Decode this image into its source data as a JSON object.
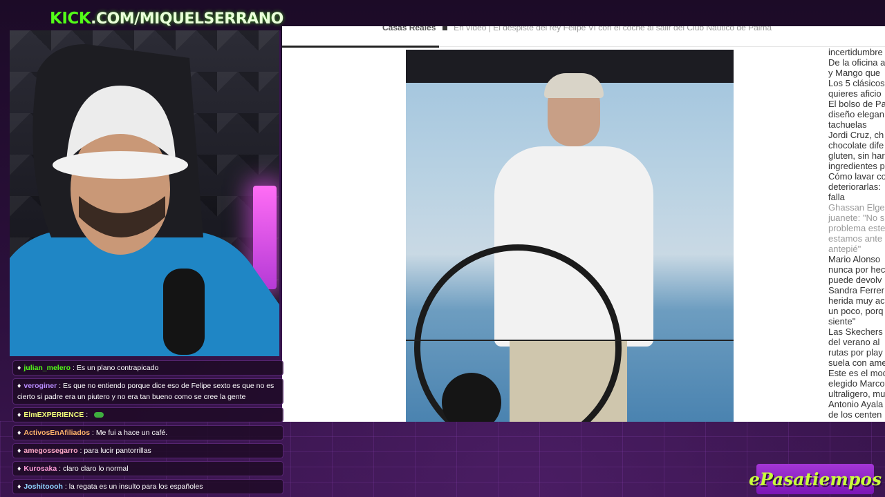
{
  "channel": {
    "prefix": "KICK",
    "rest": ".COM/MIQUELSERRANO"
  },
  "browser": {
    "breadcrumb_section": "Casas Reales",
    "breadcrumb_headline": "En vídeo | El despiste del rey Felipe VI con el coche al salir del Club Náutico de Palma",
    "progress_fraction": 0.26,
    "sidebar_lines": [
      {
        "text": "incertidumbre",
        "muted": false
      },
      {
        "text": "De la oficina a",
        "muted": false
      },
      {
        "text": "y Mango que",
        "muted": false
      },
      {
        "text": "Los 5 clásicos",
        "muted": false
      },
      {
        "text": "quieres aficio",
        "muted": false
      },
      {
        "text": "El bolso de Pa",
        "muted": false
      },
      {
        "text": "diseño elegan",
        "muted": false
      },
      {
        "text": "tachuelas",
        "muted": false
      },
      {
        "text": "Jordi Cruz, ch",
        "muted": false
      },
      {
        "text": "chocolate dife",
        "muted": false
      },
      {
        "text": "gluten, sin har",
        "muted": false
      },
      {
        "text": "ingredientes p",
        "muted": false
      },
      {
        "text": "Cómo lavar co",
        "muted": false
      },
      {
        "text": "deteriorarlas:",
        "muted": false
      },
      {
        "text": "falla",
        "muted": false
      },
      {
        "text": "Ghassan Elge",
        "muted": true
      },
      {
        "text": "juanete: \"No s",
        "muted": true
      },
      {
        "text": "problema este",
        "muted": true
      },
      {
        "text": "estamos ante",
        "muted": true
      },
      {
        "text": "antepié\"",
        "muted": true
      },
      {
        "text": "Mario Alonso",
        "muted": false
      },
      {
        "text": "nunca por hec",
        "muted": false
      },
      {
        "text": "puede devolv",
        "muted": false
      },
      {
        "text": "Sandra Ferrer",
        "muted": false
      },
      {
        "text": "herida muy ac",
        "muted": false
      },
      {
        "text": "un poco, porq",
        "muted": false
      },
      {
        "text": "siente\"",
        "muted": false
      },
      {
        "text": "Las Skechers",
        "muted": false
      },
      {
        "text": "del verano al",
        "muted": false
      },
      {
        "text": "rutas por play",
        "muted": false
      },
      {
        "text": "suela con ame",
        "muted": false
      },
      {
        "text": "Este es el mod",
        "muted": false
      },
      {
        "text": "elegido Marco",
        "muted": false
      },
      {
        "text": "ultraligero, mu",
        "muted": false
      },
      {
        "text": "Antonio Ayala",
        "muted": false
      },
      {
        "text": "de los centen",
        "muted": false
      }
    ]
  },
  "chat": [
    {
      "user": "julian_melero",
      "text": "Es un plano contrapicado",
      "color": "#53fc18"
    },
    {
      "user": "veroginer",
      "text": "Es que no entiendo porque dice eso de Felipe sexto es que no es cierto si padre era un piutero y no era tan bueno como se cree la gente",
      "color": "#b98cff"
    },
    {
      "user": "ElmEXPERIENCE",
      "text": "",
      "color": "#f3ff7a"
    },
    {
      "user": "ActivosEnAfiliados",
      "text": "Me fui a hace un café.",
      "color": "#ffb46b"
    },
    {
      "user": "amegossegarro",
      "text": "para lucir pantorrillas",
      "color": "#ffa9c7"
    },
    {
      "user": "Kurosaka",
      "text": "claro claro lo normal",
      "color": "#ff9ed9"
    },
    {
      "user": "Joshitoooh",
      "text": "la regata es un insulto para los españoles",
      "color": "#8fd3ff"
    }
  ],
  "brand": {
    "label": "ePasatiempos"
  },
  "colors": {
    "kick_green": "#53fc18",
    "brand_purple": "#8d22c6",
    "brand_text": "#c9ff3c"
  }
}
